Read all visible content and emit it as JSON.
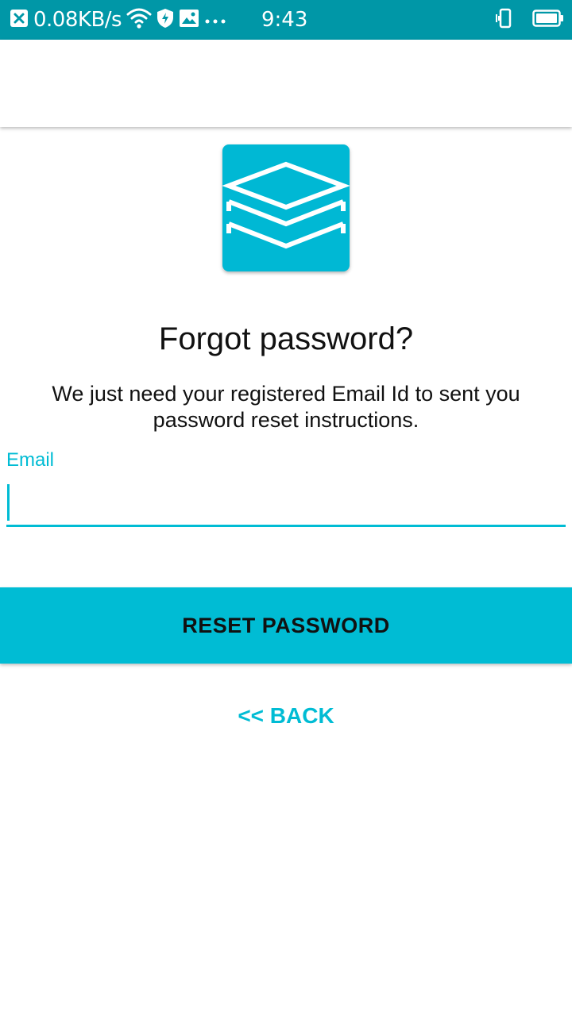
{
  "status_bar": {
    "network_speed": "0.08KB/s",
    "time": "9:43",
    "background": "#0097a7",
    "icons": {
      "left": [
        "close-notification-icon",
        "wifi-icon",
        "shield-icon",
        "image-icon",
        "more-icon"
      ],
      "right": [
        "vibrate-icon",
        "battery-icon"
      ]
    }
  },
  "logo": {
    "icon": "stacked-layers-icon",
    "background": "#00b8d4"
  },
  "form": {
    "title": "Forgot password?",
    "subtitle": "We just need your registered Email Id to sent you password reset instructions.",
    "email_label": "Email",
    "email_value": "",
    "reset_button_label": "RESET PASSWORD",
    "back_link_label": "<< BACK",
    "accent": "#00bcd4"
  }
}
